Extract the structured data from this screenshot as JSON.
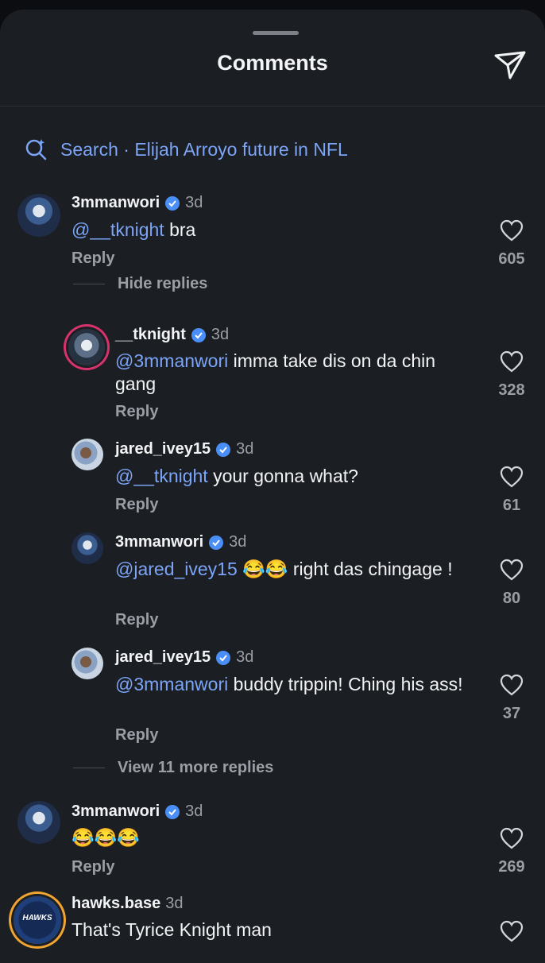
{
  "header": {
    "title": "Comments"
  },
  "search": {
    "label": "Search · Elijah Arroyo future in NFL"
  },
  "threads": {
    "hide_replies": "Hide replies",
    "view_more": "View 11 more replies"
  },
  "comments": [
    {
      "user": "3mmanwori",
      "time": "3d",
      "mention": "@__tknight",
      "text": " bra",
      "reply": "Reply",
      "likes": "605"
    },
    {
      "user": "__tknight",
      "time": "3d",
      "mention": "@3mmanwori",
      "text": " imma take dis on da chin gang",
      "reply": "Reply",
      "likes": "328"
    },
    {
      "user": "jared_ivey15",
      "time": "3d",
      "mention": "@__tknight",
      "text": " your gonna what?",
      "reply": "Reply",
      "likes": "61"
    },
    {
      "user": "3mmanwori",
      "time": "3d",
      "mention": "@jared_ivey15",
      "text": " 😂😂 right das chingage !",
      "reply": "Reply",
      "likes": "80"
    },
    {
      "user": "jared_ivey15",
      "time": "3d",
      "mention": "@3mmanwori",
      "text": " buddy trippin! Ching his ass!",
      "reply": "Reply",
      "likes": "37"
    },
    {
      "user": "3mmanwori",
      "time": "3d",
      "mention": "",
      "text": "😂😂😂",
      "reply": "Reply",
      "likes": "269"
    },
    {
      "user": "hawks.base",
      "time": "3d",
      "mention": "",
      "text": "That's Tyrice Knight man",
      "reply": "",
      "likes": "",
      "avatar_text": "HAWKS"
    }
  ],
  "colors": {
    "accent": "#7ca4f7",
    "verified": "#4a8ff7",
    "sheet": "#1b1e22",
    "muted": "#9b9fa5",
    "ring": "#d6336c"
  }
}
